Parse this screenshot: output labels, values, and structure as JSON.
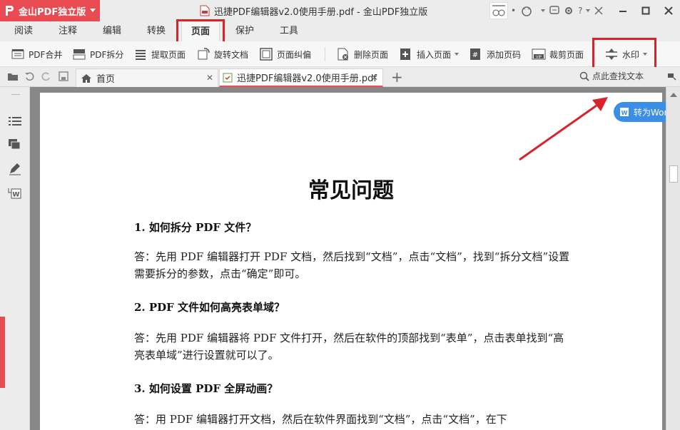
{
  "app": {
    "brand": "金山PDF独立版",
    "window_title": "迅捷PDF编辑器v2.0使用手册.pdf - 金山PDF独立版"
  },
  "menu_tabs": [
    "阅读",
    "注释",
    "编辑",
    "转换",
    "页面",
    "保护",
    "工具"
  ],
  "active_menu_tab": "页面",
  "toolbar": {
    "items": [
      {
        "label": "PDF合并",
        "icon": "merge-icon"
      },
      {
        "label": "PDF拆分",
        "icon": "split-icon"
      },
      {
        "label": "提取页面",
        "icon": "extract-icon"
      },
      {
        "label": "旋转文档",
        "icon": "rotate-icon"
      },
      {
        "label": "页面纠偏",
        "icon": "deskew-icon"
      },
      {
        "label": "删除页面",
        "icon": "delete-page-icon"
      },
      {
        "label": "插入页面",
        "icon": "insert-page-icon"
      },
      {
        "label": "添加页码",
        "icon": "page-number-icon"
      },
      {
        "label": "裁剪页面",
        "icon": "crop-icon"
      },
      {
        "label": "水印",
        "icon": "watermark-icon"
      }
    ]
  },
  "tabs": {
    "home": "首页",
    "file": "迅捷PDF编辑器v2.0使用手册.pdf",
    "search_placeholder": "点此查找文本"
  },
  "document": {
    "title": "常见问题",
    "to_word": "转为Word",
    "q1": "1. 如何拆分 PDF 文件？",
    "a1": "答：先用 PDF 编辑器打开 PDF 文档，然后找到“文档”，点击“文档”，找到“拆分文档”设置需要拆分的参数，点击“确定”即可。",
    "q2": "2. PDF 文件如何高亮表单域？",
    "a2": "答：先用 PDF 编辑器将 PDF 文件打开，然后在软件的顶部找到“表单”，点击表单找到“高亮表单域”进行设置就可以了。",
    "q3": "3. 如何设置 PDF 全屏动画？",
    "a3": "答：用 PDF 编辑器打开文档，然后在软件界面找到“文档”，点击“文档”，在下"
  },
  "colors": {
    "brand": "#e84b52",
    "highlight": "#d9232b",
    "to_word": "#3a8ee6"
  }
}
